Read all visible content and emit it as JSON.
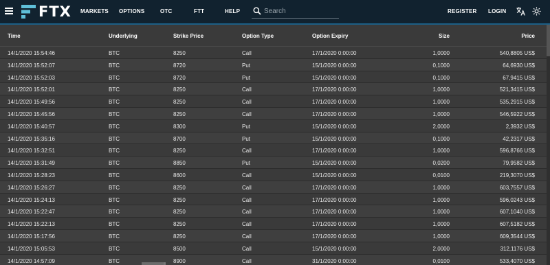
{
  "brand": {
    "name": "FTX"
  },
  "nav": {
    "markets": "MARKETS",
    "options": "OPTIONS",
    "otc": "OTC",
    "ftt": "FTT",
    "help": "HELP",
    "register": "REGISTER",
    "login": "LOGIN"
  },
  "search": {
    "placeholder": "Search",
    "value": ""
  },
  "icons": {
    "menu": "menu-icon",
    "search": "search-icon",
    "translate": "translate-icon",
    "theme": "brightness-icon"
  },
  "colors": {
    "topbar": "#11222f",
    "accent": "#1c5f86",
    "table_bg": "#3a3a3a",
    "logo": "#5fc0d9"
  },
  "table": {
    "columns": [
      "Time",
      "Underlying",
      "Strike Price",
      "Option Type",
      "Option Expiry",
      "Size",
      "Price"
    ],
    "rows": [
      [
        "14/1/2020 15:54:46",
        "BTC",
        "8250",
        "Call",
        "17/1/2020 0:00:00",
        "1,0000",
        "540,8805 US$"
      ],
      [
        "14/1/2020 15:52:07",
        "BTC",
        "8720",
        "Put",
        "15/1/2020 0:00:00",
        "0,1000",
        "64,6930 US$"
      ],
      [
        "14/1/2020 15:52:03",
        "BTC",
        "8720",
        "Put",
        "15/1/2020 0:00:00",
        "0,1000",
        "67,9415 US$"
      ],
      [
        "14/1/2020 15:52:01",
        "BTC",
        "8250",
        "Call",
        "17/1/2020 0:00:00",
        "1,0000",
        "521,3415 US$"
      ],
      [
        "14/1/2020 15:49:56",
        "BTC",
        "8250",
        "Call",
        "17/1/2020 0:00:00",
        "1,0000",
        "535,2915 US$"
      ],
      [
        "14/1/2020 15:45:56",
        "BTC",
        "8250",
        "Call",
        "17/1/2020 0:00:00",
        "1,0000",
        "546,5922 US$"
      ],
      [
        "14/1/2020 15:40:57",
        "BTC",
        "8300",
        "Put",
        "15/1/2020 0:00:00",
        "2,0000",
        "2,3932 US$"
      ],
      [
        "14/1/2020 15:35:16",
        "BTC",
        "8700",
        "Put",
        "15/1/2020 0:00:00",
        "0,1000",
        "42,2317 US$"
      ],
      [
        "14/1/2020 15:32:51",
        "BTC",
        "8250",
        "Call",
        "17/1/2020 0:00:00",
        "1,0000",
        "596,8766 US$"
      ],
      [
        "14/1/2020 15:31:49",
        "BTC",
        "8850",
        "Put",
        "15/1/2020 0:00:00",
        "0,0200",
        "79,9582 US$"
      ],
      [
        "14/1/2020 15:28:23",
        "BTC",
        "8600",
        "Call",
        "15/1/2020 0:00:00",
        "0,0100",
        "219,3070 US$"
      ],
      [
        "14/1/2020 15:26:27",
        "BTC",
        "8250",
        "Call",
        "17/1/2020 0:00:00",
        "1,0000",
        "603,7557 US$"
      ],
      [
        "14/1/2020 15:24:13",
        "BTC",
        "8250",
        "Call",
        "17/1/2020 0:00:00",
        "1,0000",
        "596,0243 US$"
      ],
      [
        "14/1/2020 15:22:47",
        "BTC",
        "8250",
        "Call",
        "17/1/2020 0:00:00",
        "1,0000",
        "607,1040 US$"
      ],
      [
        "14/1/2020 15:22:13",
        "BTC",
        "8250",
        "Call",
        "17/1/2020 0:00:00",
        "1,0000",
        "607,5182 US$"
      ],
      [
        "14/1/2020 15:17:56",
        "BTC",
        "8250",
        "Call",
        "17/1/2020 0:00:00",
        "1,0000",
        "609,3544 US$"
      ],
      [
        "14/1/2020 15:05:53",
        "BTC",
        "8500",
        "Call",
        "15/1/2020 0:00:00",
        "2,0000",
        "312,1176 US$"
      ],
      [
        "14/1/2020 14:57:09",
        "BTC",
        "8900",
        "Call",
        "31/1/2020 0:00:00",
        "0,0100",
        "533,4070 US$"
      ]
    ]
  }
}
